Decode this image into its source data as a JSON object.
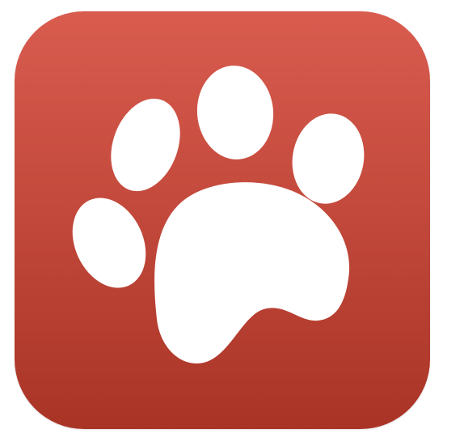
{
  "app_icon": {
    "icon_name": "paw-print-icon",
    "colors": {
      "gradient_top": "#d95c4f",
      "gradient_bottom": "#a93426",
      "glyph": "#ffffff",
      "page_background": "#ffffff"
    }
  }
}
